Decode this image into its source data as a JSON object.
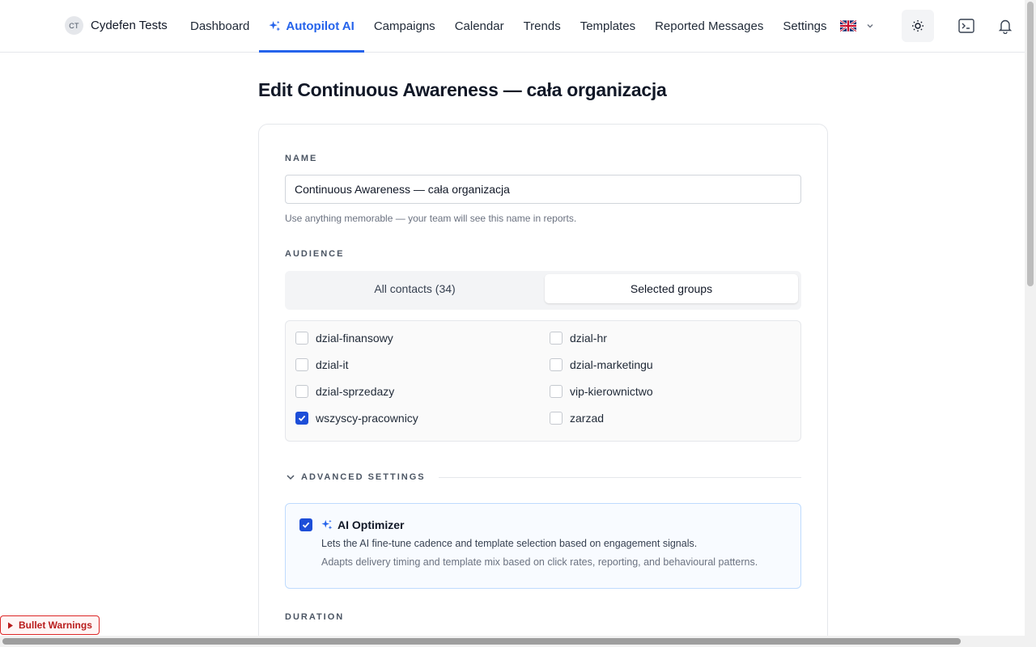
{
  "brand": {
    "initials": "CT",
    "name": "Cydefen Tests"
  },
  "nav": {
    "items": [
      {
        "label": "Dashboard"
      },
      {
        "label": "Autopilot AI"
      },
      {
        "label": "Campaigns"
      },
      {
        "label": "Calendar"
      },
      {
        "label": "Trends"
      },
      {
        "label": "Templates"
      },
      {
        "label": "Reported Messages"
      },
      {
        "label": "Settings"
      }
    ],
    "active": "Autopilot AI",
    "language_flag": "uk-flag-icon"
  },
  "page": {
    "title": "Edit Continuous Awareness — cała organizacja"
  },
  "form": {
    "name_label": "NAME",
    "name_value": "Continuous Awareness — cała organizacja",
    "name_hint": "Use anything memorable — your team will see this name in reports.",
    "audience_label": "AUDIENCE",
    "audience_options": [
      "All contacts (34)",
      "Selected groups"
    ],
    "audience_selected": "Selected groups",
    "groups": [
      {
        "name": "dzial-finansowy",
        "checked": false
      },
      {
        "name": "dzial-hr",
        "checked": false
      },
      {
        "name": "dzial-it",
        "checked": false
      },
      {
        "name": "dzial-marketingu",
        "checked": false
      },
      {
        "name": "dzial-sprzedazy",
        "checked": false
      },
      {
        "name": "vip-kierownictwo",
        "checked": false
      },
      {
        "name": "wszyscy-pracownicy",
        "checked": true
      },
      {
        "name": "zarzad",
        "checked": false
      }
    ],
    "advanced_label": "ADVANCED SETTINGS",
    "ai_optimizer": {
      "enabled": true,
      "title": "AI Optimizer",
      "line1": "Lets the AI fine-tune cadence and template selection based on engagement signals.",
      "line2": "Adapts delivery timing and template mix based on click rates, reporting, and behavioural patterns."
    },
    "duration_label": "DURATION"
  },
  "warnings": {
    "label": "Bullet Warnings"
  },
  "colors": {
    "accent": "#2563eb",
    "checkbox": "#1d4ed8",
    "warning": "#dc2626"
  }
}
